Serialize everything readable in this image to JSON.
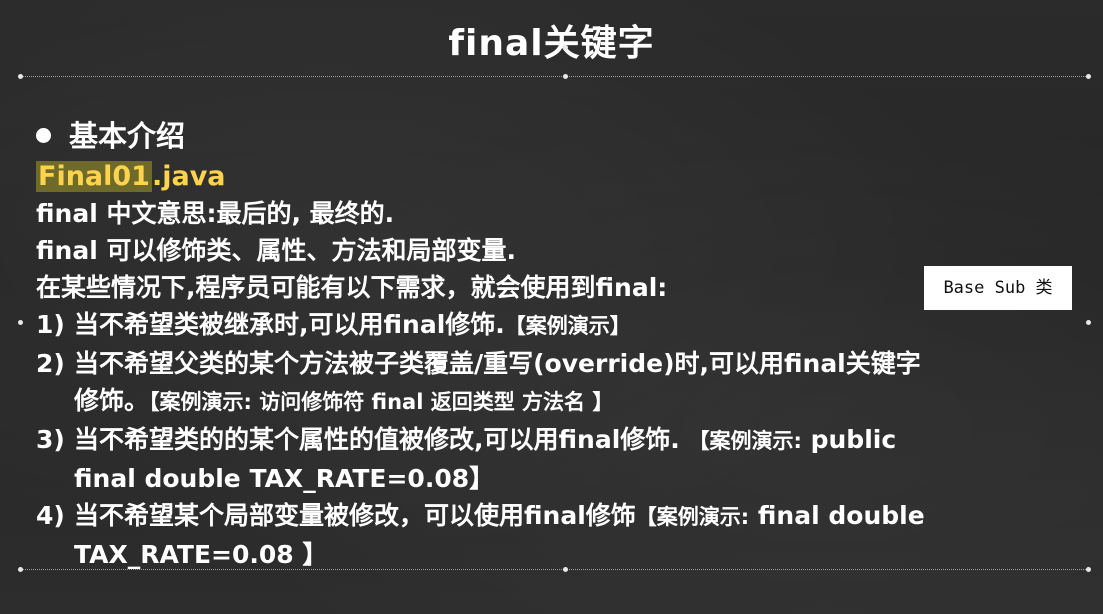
{
  "slide": {
    "title": "final关键字",
    "heading": "基本介绍",
    "file_name_base": "Final01",
    "file_name_ext": ".java",
    "lines": [
      "final 中文意思:最后的, 最终的.",
      "final 可以修饰类、属性、方法和局部变量.",
      "在某些情况下,程序员可能有以下需求，就会使用到final:"
    ],
    "items": [
      {
        "num": "1)",
        "text": "当不希望类被继承时,可以用final修饰.",
        "note": "【案例演示】"
      },
      {
        "num": "2)",
        "text": "当不希望父类的某个方法被子类覆盖/重写(override)时,可以用final关键字",
        "cont": "修饰。",
        "note": "【案例演示: 访问修饰符 final 返回类型 方法名 】"
      },
      {
        "num": "3)",
        "text": "当不希望类的的某个属性的值被修改,可以用final修饰.",
        "note": "【案例演示:",
        "note_tail": "public",
        "cont": "final double TAX_RATE=0.08】"
      },
      {
        "num": "4)",
        "text": "当不希望某个局部变量被修改，可以使用final修饰",
        "note": "【案例演示:",
        "note_tail": "final double",
        "cont": "TAX_RATE=0.08 】"
      }
    ]
  },
  "badge": {
    "label": "Base Sub 类"
  }
}
